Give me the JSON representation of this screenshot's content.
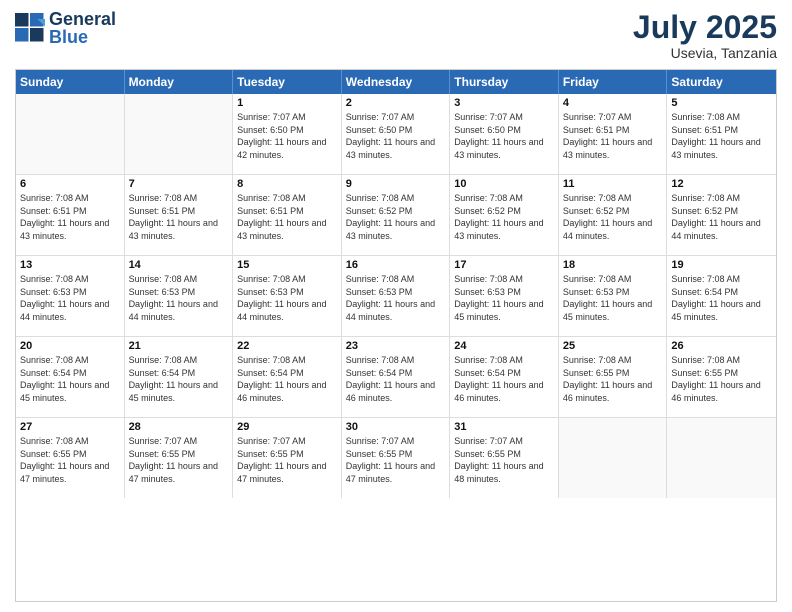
{
  "header": {
    "logo_general": "General",
    "logo_blue": "Blue",
    "month_title": "July 2025",
    "location": "Usevia, Tanzania"
  },
  "days": [
    "Sunday",
    "Monday",
    "Tuesday",
    "Wednesday",
    "Thursday",
    "Friday",
    "Saturday"
  ],
  "rows": [
    [
      {
        "day": "",
        "empty": true
      },
      {
        "day": "",
        "empty": true
      },
      {
        "day": "1",
        "sunrise": "7:07 AM",
        "sunset": "6:50 PM",
        "daylight": "11 hours and 42 minutes."
      },
      {
        "day": "2",
        "sunrise": "7:07 AM",
        "sunset": "6:50 PM",
        "daylight": "11 hours and 43 minutes."
      },
      {
        "day": "3",
        "sunrise": "7:07 AM",
        "sunset": "6:50 PM",
        "daylight": "11 hours and 43 minutes."
      },
      {
        "day": "4",
        "sunrise": "7:07 AM",
        "sunset": "6:51 PM",
        "daylight": "11 hours and 43 minutes."
      },
      {
        "day": "5",
        "sunrise": "7:08 AM",
        "sunset": "6:51 PM",
        "daylight": "11 hours and 43 minutes."
      }
    ],
    [
      {
        "day": "6",
        "sunrise": "7:08 AM",
        "sunset": "6:51 PM",
        "daylight": "11 hours and 43 minutes."
      },
      {
        "day": "7",
        "sunrise": "7:08 AM",
        "sunset": "6:51 PM",
        "daylight": "11 hours and 43 minutes."
      },
      {
        "day": "8",
        "sunrise": "7:08 AM",
        "sunset": "6:51 PM",
        "daylight": "11 hours and 43 minutes."
      },
      {
        "day": "9",
        "sunrise": "7:08 AM",
        "sunset": "6:52 PM",
        "daylight": "11 hours and 43 minutes."
      },
      {
        "day": "10",
        "sunrise": "7:08 AM",
        "sunset": "6:52 PM",
        "daylight": "11 hours and 43 minutes."
      },
      {
        "day": "11",
        "sunrise": "7:08 AM",
        "sunset": "6:52 PM",
        "daylight": "11 hours and 44 minutes."
      },
      {
        "day": "12",
        "sunrise": "7:08 AM",
        "sunset": "6:52 PM",
        "daylight": "11 hours and 44 minutes."
      }
    ],
    [
      {
        "day": "13",
        "sunrise": "7:08 AM",
        "sunset": "6:53 PM",
        "daylight": "11 hours and 44 minutes."
      },
      {
        "day": "14",
        "sunrise": "7:08 AM",
        "sunset": "6:53 PM",
        "daylight": "11 hours and 44 minutes."
      },
      {
        "day": "15",
        "sunrise": "7:08 AM",
        "sunset": "6:53 PM",
        "daylight": "11 hours and 44 minutes."
      },
      {
        "day": "16",
        "sunrise": "7:08 AM",
        "sunset": "6:53 PM",
        "daylight": "11 hours and 44 minutes."
      },
      {
        "day": "17",
        "sunrise": "7:08 AM",
        "sunset": "6:53 PM",
        "daylight": "11 hours and 45 minutes."
      },
      {
        "day": "18",
        "sunrise": "7:08 AM",
        "sunset": "6:53 PM",
        "daylight": "11 hours and 45 minutes."
      },
      {
        "day": "19",
        "sunrise": "7:08 AM",
        "sunset": "6:54 PM",
        "daylight": "11 hours and 45 minutes."
      }
    ],
    [
      {
        "day": "20",
        "sunrise": "7:08 AM",
        "sunset": "6:54 PM",
        "daylight": "11 hours and 45 minutes."
      },
      {
        "day": "21",
        "sunrise": "7:08 AM",
        "sunset": "6:54 PM",
        "daylight": "11 hours and 45 minutes."
      },
      {
        "day": "22",
        "sunrise": "7:08 AM",
        "sunset": "6:54 PM",
        "daylight": "11 hours and 46 minutes."
      },
      {
        "day": "23",
        "sunrise": "7:08 AM",
        "sunset": "6:54 PM",
        "daylight": "11 hours and 46 minutes."
      },
      {
        "day": "24",
        "sunrise": "7:08 AM",
        "sunset": "6:54 PM",
        "daylight": "11 hours and 46 minutes."
      },
      {
        "day": "25",
        "sunrise": "7:08 AM",
        "sunset": "6:55 PM",
        "daylight": "11 hours and 46 minutes."
      },
      {
        "day": "26",
        "sunrise": "7:08 AM",
        "sunset": "6:55 PM",
        "daylight": "11 hours and 46 minutes."
      }
    ],
    [
      {
        "day": "27",
        "sunrise": "7:08 AM",
        "sunset": "6:55 PM",
        "daylight": "11 hours and 47 minutes."
      },
      {
        "day": "28",
        "sunrise": "7:07 AM",
        "sunset": "6:55 PM",
        "daylight": "11 hours and 47 minutes."
      },
      {
        "day": "29",
        "sunrise": "7:07 AM",
        "sunset": "6:55 PM",
        "daylight": "11 hours and 47 minutes."
      },
      {
        "day": "30",
        "sunrise": "7:07 AM",
        "sunset": "6:55 PM",
        "daylight": "11 hours and 47 minutes."
      },
      {
        "day": "31",
        "sunrise": "7:07 AM",
        "sunset": "6:55 PM",
        "daylight": "11 hours and 48 minutes."
      },
      {
        "day": "",
        "empty": true
      },
      {
        "day": "",
        "empty": true
      }
    ]
  ]
}
